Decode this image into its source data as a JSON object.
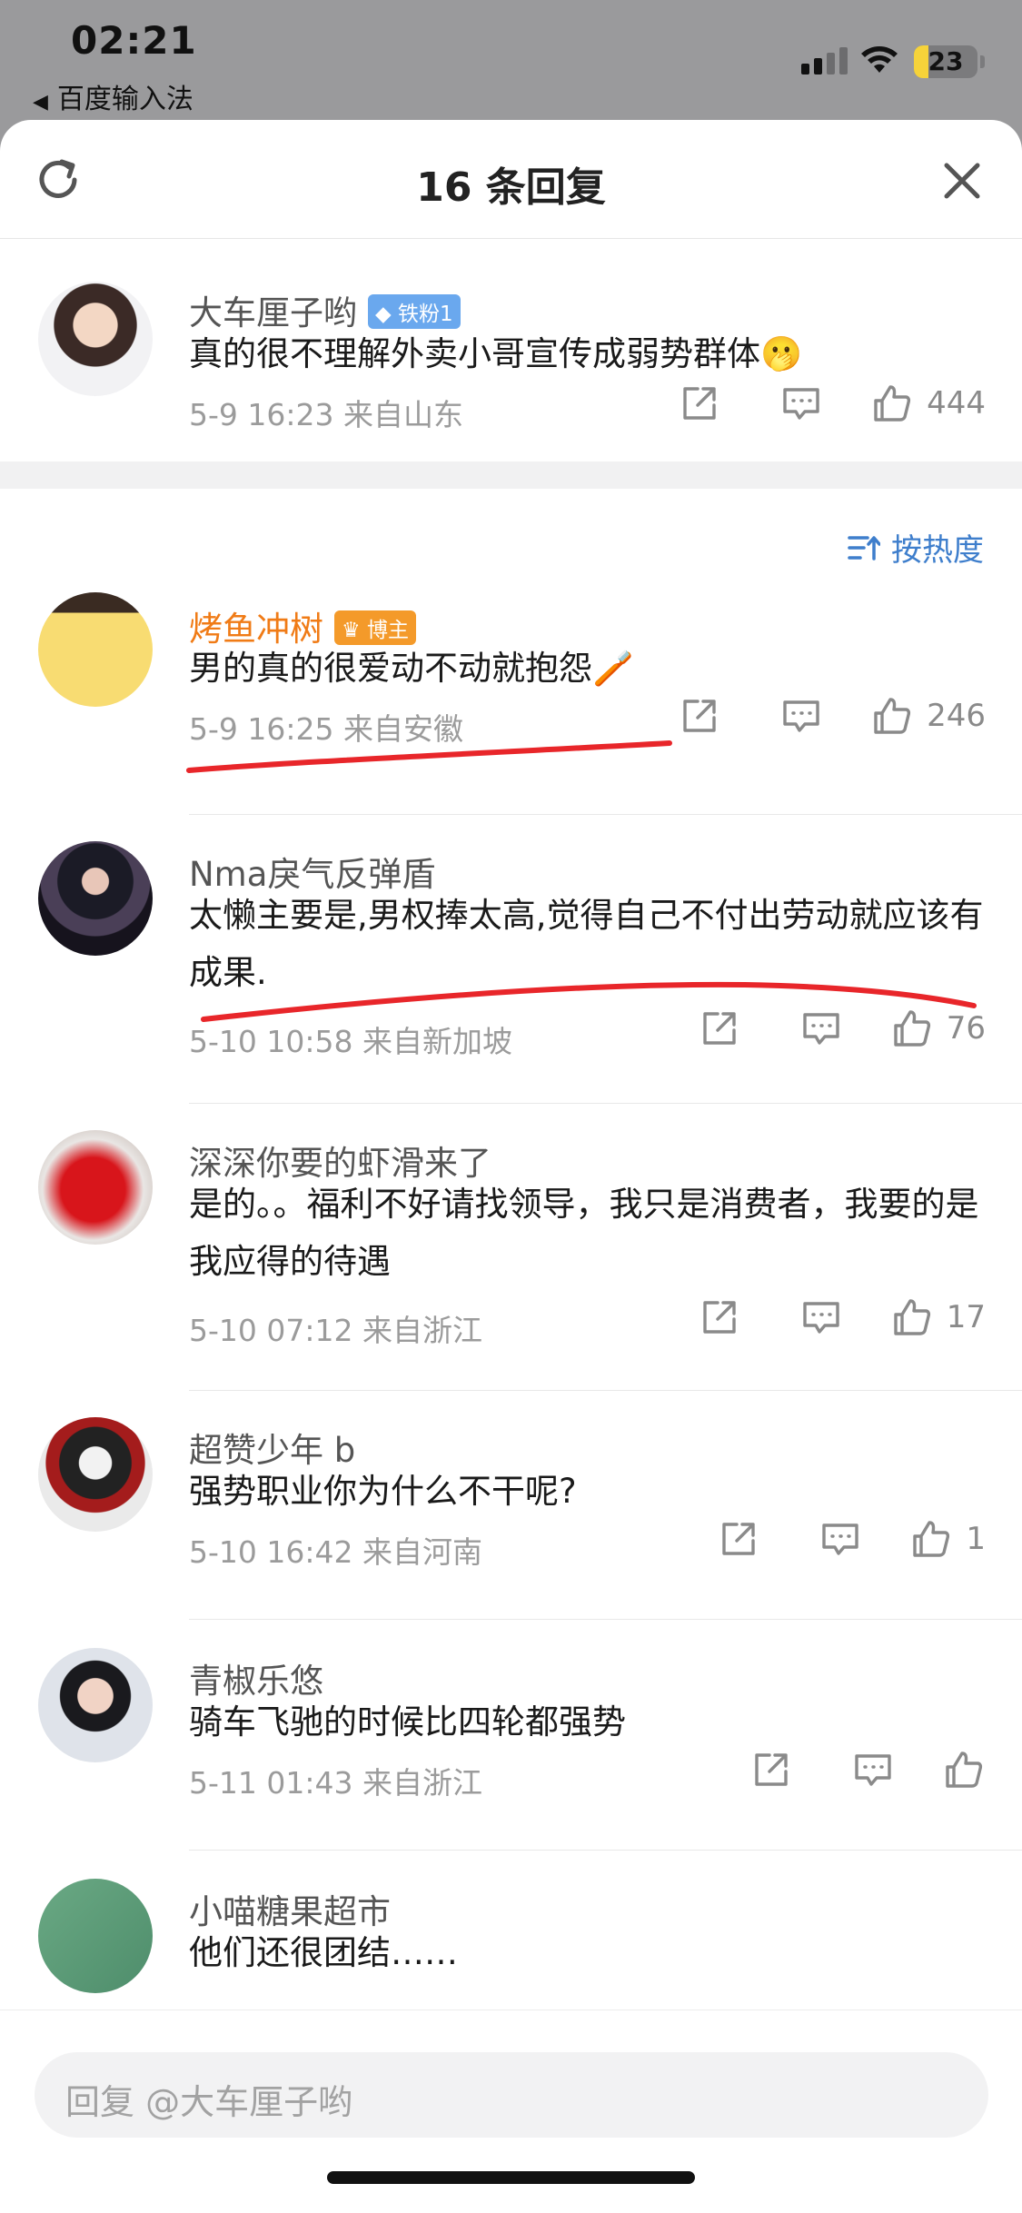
{
  "status_bar": {
    "time": "02:21",
    "back_app": "百度输入法",
    "battery": "23",
    "battery_level": 0.23
  },
  "sheet": {
    "title": "16 条回复",
    "sort_label": "按热度"
  },
  "root_comment": {
    "name": "大车厘子哟",
    "badge": "铁粉1",
    "text": "真的很不理解外卖小哥宣传成弱势群体🫢",
    "meta": "5-9 16:23  来自山东",
    "likes": "444"
  },
  "replies": [
    {
      "name": "烤鱼冲树",
      "badge": "博主",
      "text": "男的真的很爱动不动就抱怨🪥",
      "meta": "5-9 16:25  来自安徽",
      "likes": "246"
    },
    {
      "name": "Nma戾气反弹盾",
      "text": "太懒主要是,男权捧太高,觉得自己不付出劳动就应该有成果.",
      "meta": "5-10 10:58  来自新加坡",
      "likes": "76"
    },
    {
      "name": "深深你要的虾滑来了",
      "text": "是的。。福利不好请找领导，我只是消费者，我要的是我应得的待遇",
      "meta": "5-10 07:12  来自浙江",
      "likes": "17"
    },
    {
      "name": "超赞少年 b",
      "text": "强势职业你为什么不干呢?",
      "meta": "5-10 16:42  来自河南",
      "likes": "1"
    },
    {
      "name": "青椒乐悠",
      "text": "骑车飞驰的时候比四轮都强势",
      "meta": "5-11 01:43  来自浙江",
      "likes": ""
    },
    {
      "name": "小喵糖果超市",
      "text": "他们还很团结……"
    }
  ],
  "reply_bar": {
    "placeholder": "回复 @大车厘子哟"
  },
  "colors": {
    "host_name": "#f07b16",
    "accent": "#3e7ecc",
    "annotation": "#e8262a"
  }
}
